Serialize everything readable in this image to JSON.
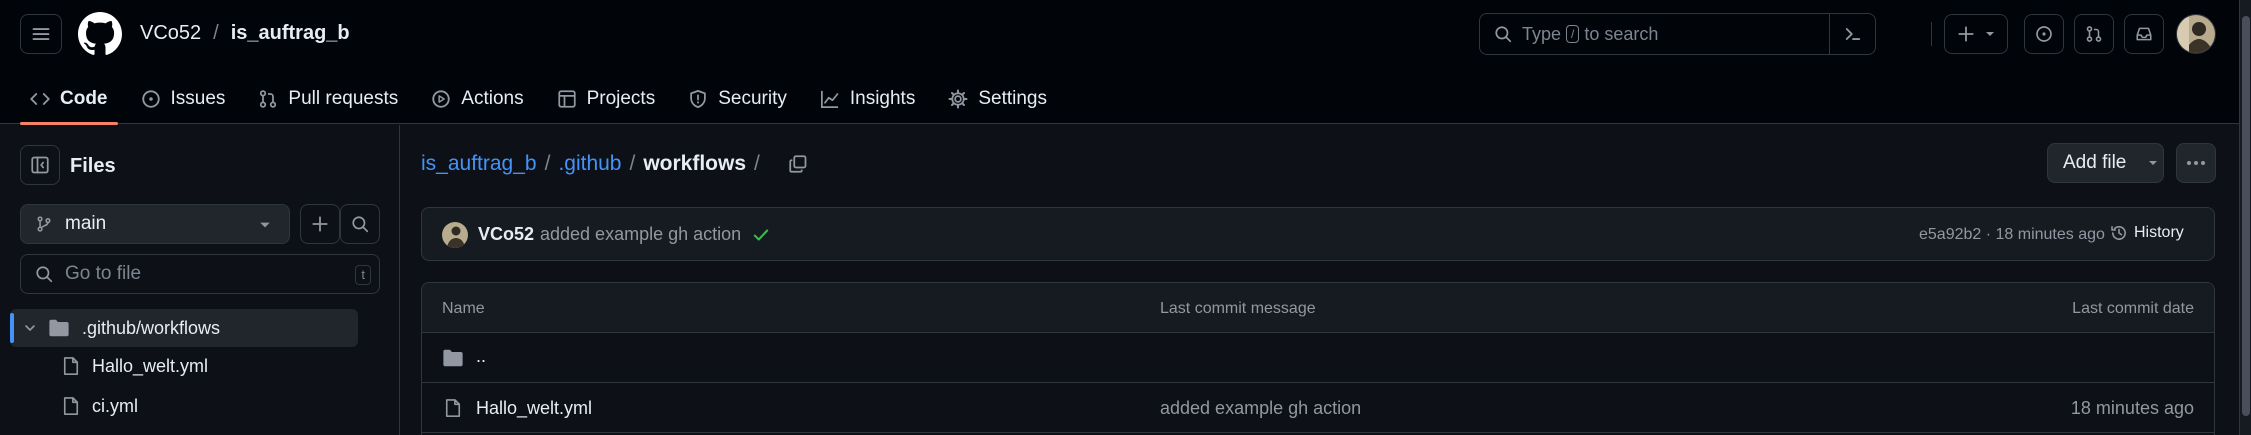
{
  "header": {
    "owner": "VCo52",
    "separator": "/",
    "repo": "is_auftrag_b",
    "search": {
      "prefix": "Type",
      "key": "/",
      "suffix": "to search"
    }
  },
  "repo_tabs": [
    {
      "label": "Code",
      "icon": "code-icon",
      "active": true
    },
    {
      "label": "Issues",
      "icon": "issue-icon"
    },
    {
      "label": "Pull requests",
      "icon": "pull-request-icon"
    },
    {
      "label": "Actions",
      "icon": "play-icon"
    },
    {
      "label": "Projects",
      "icon": "table-icon"
    },
    {
      "label": "Security",
      "icon": "shield-icon"
    },
    {
      "label": "Insights",
      "icon": "graph-icon"
    },
    {
      "label": "Settings",
      "icon": "gear-icon"
    }
  ],
  "sidebar": {
    "title": "Files",
    "branch": "main",
    "goto_placeholder": "Go to file",
    "goto_key": "t",
    "tree": [
      {
        "label": ".github/workflows",
        "type": "folder",
        "selected": true
      },
      {
        "label": "Hallo_welt.yml",
        "type": "file"
      },
      {
        "label": "ci.yml",
        "type": "file"
      }
    ]
  },
  "main": {
    "breadcrumb": {
      "root": "is_auftrag_b",
      "sep": "/",
      "dir": ".github",
      "current": "workflows"
    },
    "add_file": "Add file",
    "commit": {
      "author": "VCo52",
      "message": "added example gh action",
      "meta": "e5a92b2 · 18 minutes ago",
      "history": "History"
    },
    "table": {
      "headers": {
        "name": "Name",
        "message": "Last commit message",
        "date": "Last commit date"
      },
      "parent": "..",
      "rows": [
        {
          "name": "Hallo_welt.yml",
          "message": "added example gh action",
          "date": "18 minutes ago"
        }
      ]
    }
  },
  "colors": {
    "accent": "#4493f8",
    "active_tab_underline": "#f78166",
    "success": "#3fb950",
    "background": "#0d1117",
    "header_background": "#010409"
  }
}
